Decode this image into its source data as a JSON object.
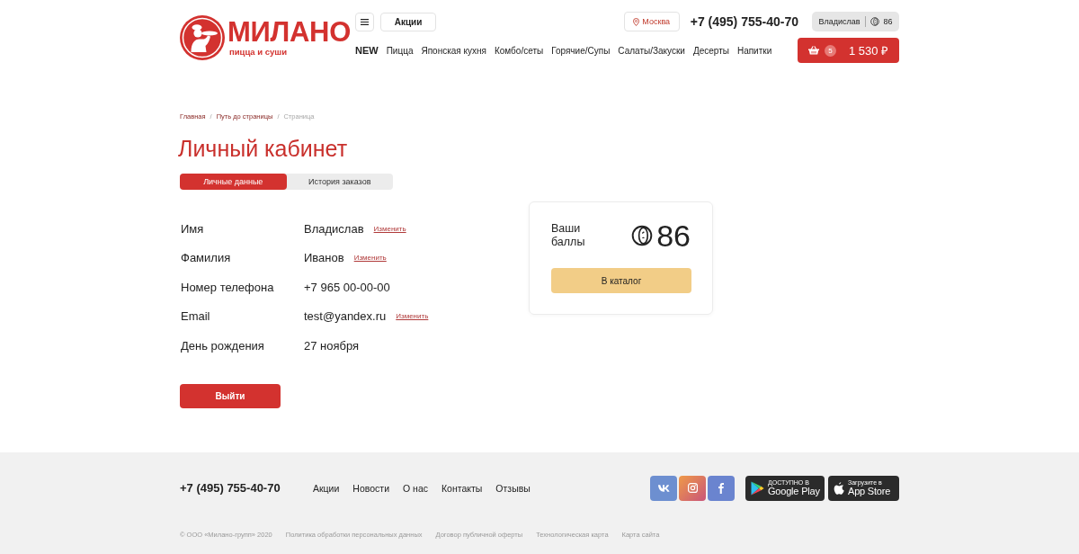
{
  "header": {
    "logo": {
      "name": "МИЛАНО",
      "tagline": "пицца и суши"
    },
    "promo_button": "Акции",
    "city": "Москва",
    "phone": "+7 (495) 755-40-70",
    "user": {
      "name": "Владислав",
      "points": "86"
    },
    "nav": [
      {
        "label": "NEW",
        "kind": "new"
      },
      {
        "label": "Пицца",
        "kind": "category"
      },
      {
        "label": "Японская кухня",
        "kind": "category"
      },
      {
        "label": "Комбо/сеты",
        "kind": "category"
      },
      {
        "label": "Горячие/Супы",
        "kind": "category"
      },
      {
        "label": "Салаты/Закуски",
        "kind": "category"
      },
      {
        "label": "Десерты",
        "kind": "category"
      },
      {
        "label": "Напитки",
        "kind": "category"
      }
    ],
    "cart": {
      "count": "5",
      "total": "1 530 ₽"
    }
  },
  "breadcrumbs": {
    "separator": "/",
    "items": [
      {
        "label": "Главная",
        "current": false
      },
      {
        "label": "Путь до страницы",
        "current": false
      },
      {
        "label": "Страница",
        "current": true
      }
    ]
  },
  "title": "Личный кабинет",
  "tabs": [
    {
      "label": "Личные данные",
      "selected": true
    },
    {
      "label": "История заказов",
      "selected": false
    }
  ],
  "profile_fields": [
    {
      "label": "Имя",
      "value": "Владислав",
      "action": "Изменить"
    },
    {
      "label": "Фамилия",
      "value": "Иванов",
      "action": "Изменить"
    },
    {
      "label": "Номер телефона",
      "value": "+7 965 00-00-00"
    },
    {
      "label": "Email",
      "value": "test@yandex.ru",
      "action": "Изменить"
    },
    {
      "label": "День рождения",
      "value": "27 ноября"
    }
  ],
  "logout_button": "Выйти",
  "points_card": {
    "label": "Ваши баллы",
    "points": "86",
    "button": "В каталог"
  },
  "footer": {
    "phone": "+7 (495) 755-40-70",
    "links": [
      "Акции",
      "Новости",
      "О нас",
      "Контакты",
      "Отзывы"
    ],
    "social": [
      {
        "kind": "vk"
      },
      {
        "kind": "instagram"
      },
      {
        "kind": "facebook"
      }
    ],
    "stores": [
      {
        "kind": "google-play",
        "caption": "ДОСТУПНО В",
        "name": "Google Play"
      },
      {
        "kind": "app-store",
        "caption": "Загрузите в",
        "name": "App Store"
      }
    ],
    "legal": [
      "© ООО «Милано-групп» 2020",
      "Политика обработки персональных данных",
      "Договор публичной оферты",
      "Технологическая карта",
      "Карта сайта"
    ]
  }
}
